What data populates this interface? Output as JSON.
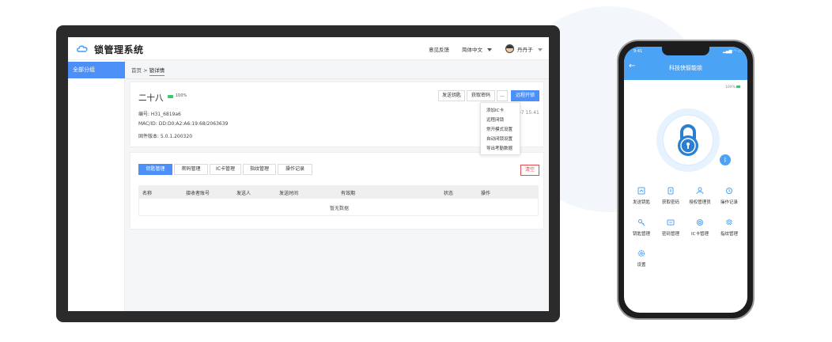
{
  "app": {
    "title": "锁管理系统",
    "feedback_label": "意见反馈",
    "language": "简体中文",
    "user_name": "丹丹子"
  },
  "sidebar": {
    "items": [
      {
        "label": "全部分组",
        "active": true
      }
    ]
  },
  "breadcrumb": {
    "home": "首页",
    "separator": ">",
    "current": "锁详情"
  },
  "lock": {
    "name": "二十八",
    "battery": "100%",
    "serial": "编号: H31_6819a6",
    "mac": "MAC/ID:  DD:D0:A2:A6:19:68/2063639",
    "firmware": "固件版本:  5.0.1.200320",
    "time_partial": "07 15:41"
  },
  "actions": {
    "send_key": "发送钥匙",
    "get_password": "获取密码",
    "more": "...",
    "remote_unlock": "远程开锁"
  },
  "more_menu": [
    "添加IC卡",
    "远程闭锁",
    "常开模式设置",
    "自动闭锁设置",
    "导出考勤数据"
  ],
  "tabs": [
    {
      "label": "钥匙管理",
      "active": true
    },
    {
      "label": "密码管理",
      "active": false
    },
    {
      "label": "IC卡管理",
      "active": false
    },
    {
      "label": "指纹管理",
      "active": false
    },
    {
      "label": "操作记录",
      "active": false
    }
  ],
  "clear_label": "清空",
  "table": {
    "headers": [
      "名称",
      "接收者账号",
      "发送人",
      "发送时间",
      "有效期",
      "状态",
      "操作"
    ],
    "empty_text": "暂无数据"
  },
  "phone": {
    "time": "9:41",
    "status": "▂▄▆ ◠ ▭",
    "back": "←",
    "title": "科技侠智能锁",
    "battery": "100%",
    "bluetooth": "ᛒ",
    "grid": [
      "发送钥匙",
      "获取密码",
      "授权管理员",
      "操作记录",
      "钥匙管理",
      "密码管理",
      "IC卡管理",
      "指纹管理",
      "设置"
    ]
  },
  "colors": {
    "primary": "#4b8ff7",
    "phone_header": "#4ba3f5",
    "danger": "#e64b4b",
    "battery_green": "#3cc56a"
  }
}
